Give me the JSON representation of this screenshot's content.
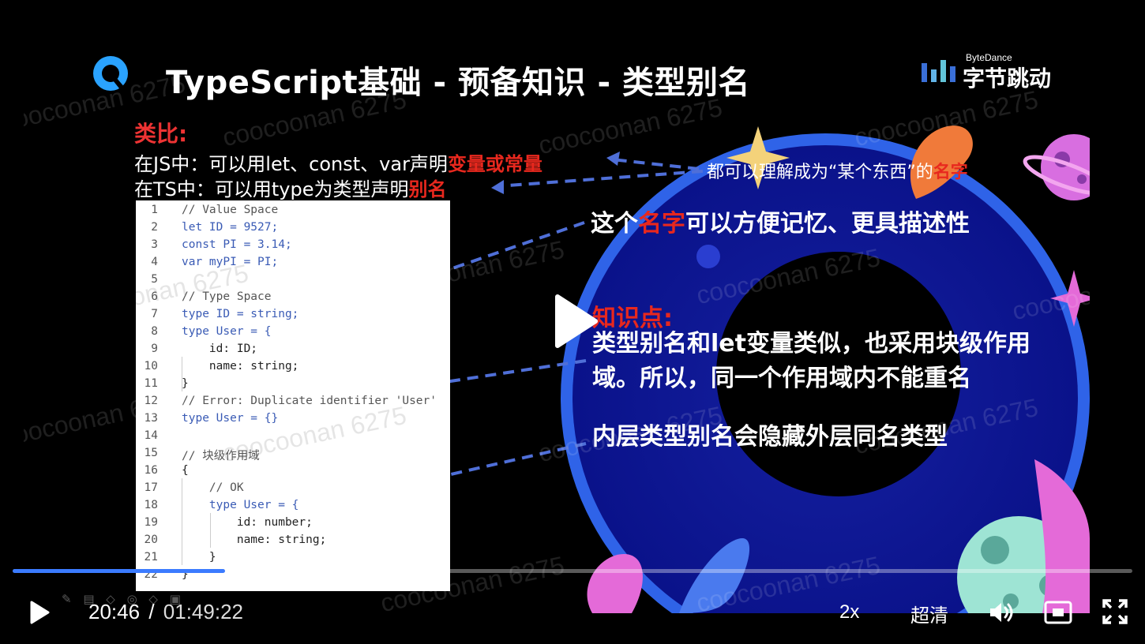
{
  "slide": {
    "title": "TypeScript基础 - 预备知识 - 类型别名",
    "brand_en": "ByteDance",
    "brand_cn": "字节跳动",
    "analogy_label": "类比:",
    "line1_prefix": "在JS中：可以用let、const、var声明",
    "line1_highlight": "变量或常量",
    "line2_prefix": "在TS中：可以用type为类型声明",
    "line2_highlight": "别名",
    "note1_prefix": "都可以理解成为“某个东西”的",
    "note1_highlight": "名字",
    "note2_prefix": "这个",
    "note2_highlight": "名字",
    "note2_suffix": "可以方便记忆、更具描述性",
    "kp_title": "知识点:",
    "kp1": "类型别名和let变量类似，也采用块级作用域。所以，同一个作用域内不能重名",
    "kp2": "内层类型别名会隐藏外层同名类型",
    "watermark": "coocoonan 6275"
  },
  "code_lines": [
    "// Value Space",
    "let ID = 9527;",
    "const PI = 3.14;",
    "var myPI = PI;",
    "",
    "// Type Space",
    "type ID = string;",
    "type User = {",
    "    id: ID;",
    "    name: string;",
    "}",
    "// Error: Duplicate identifier 'User'",
    "type User = {}",
    "",
    "// 块级作用域",
    "{",
    "    // OK",
    "    type User = {",
    "        id: number;",
    "        name: string;",
    "    }",
    "}"
  ],
  "controls": {
    "current_time": "20:46",
    "separator": "/",
    "duration": "01:49:22",
    "speed": "2x",
    "quality": "超清",
    "progress": 0.19
  },
  "colors": {
    "accent": "#3b7bff",
    "highlight_red": "#e8281e",
    "ring_blue": "#1a1fa8"
  },
  "icons": [
    "play-icon",
    "volume-icon",
    "picture-in-picture-icon",
    "fullscreen-icon",
    "big-play-icon"
  ]
}
